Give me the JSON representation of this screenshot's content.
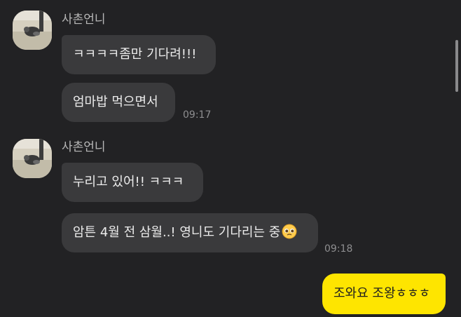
{
  "groups": [
    {
      "sender": "사촌언니",
      "messages": [
        {
          "text": "ㅋㅋㅋㅋ좀만 기다려!!!"
        },
        {
          "text": "엄마밥 먹으면서",
          "time": "09:17"
        }
      ]
    },
    {
      "sender": "사촌언니",
      "messages": [
        {
          "text": "누리고 있어!! ㅋㅋㅋ"
        },
        {
          "text": "암튼 4월 전 삼월..! 영니도 기다리는 중",
          "emoji": "pleading-face-icon",
          "time": "09:18"
        }
      ]
    }
  ],
  "my_messages": [
    {
      "text": "조와요 조왕ㅎㅎㅎ"
    }
  ],
  "colors": {
    "background": "#222224",
    "bubble_other": "#3a3a3c",
    "bubble_mine": "#fee500",
    "sender_text": "#b8b8b8",
    "time_text": "#8e8e90"
  }
}
